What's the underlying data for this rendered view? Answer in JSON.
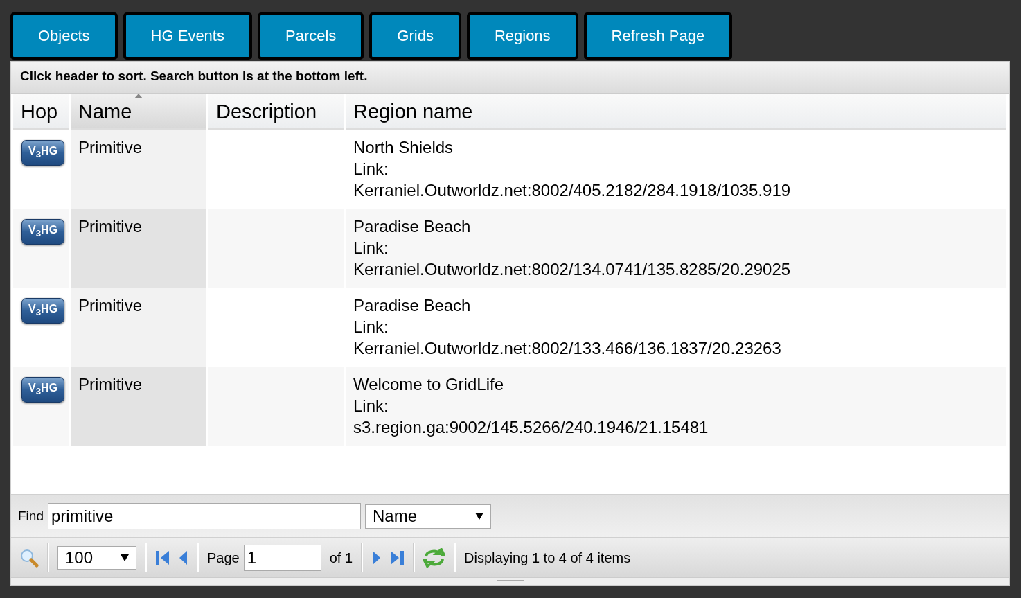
{
  "tabs": [
    {
      "label": "Objects"
    },
    {
      "label": "HG Events"
    },
    {
      "label": "Parcels"
    },
    {
      "label": "Grids"
    },
    {
      "label": "Regions"
    },
    {
      "label": "Refresh Page"
    }
  ],
  "hint": "Click header to sort. Search button is at the bottom left.",
  "columns": [
    {
      "label": "Hop",
      "sorted": false
    },
    {
      "label": "Name",
      "sorted": true
    },
    {
      "label": "Description",
      "sorted": false
    },
    {
      "label": "Region name",
      "sorted": false
    }
  ],
  "rows": [
    {
      "hop": "V$_{3}$HG",
      "name": "Primitive",
      "region": "North Shields",
      "link_label": "Link:",
      "link": "Kerraniel.Outworldz.net:8002/405.2182/284.1918/1035.919"
    },
    {
      "hop": "V$_{3}$HG",
      "name": "Primitive",
      "region": "Paradise Beach",
      "link_label": "Link:",
      "link": "Kerraniel.Outworldz.net:8002/134.0741/135.8285/20.29025"
    },
    {
      "hop": "V$_{3}$HG",
      "name": "Primitive",
      "region": "Paradise Beach",
      "link_label": "Link:",
      "link": "Kerraniel.Outworldz.net:8002/133.466/136.1837/20.23263"
    },
    {
      "hop": "V$_{3}$HG",
      "name": "Primitive",
      "region": "Welcome to GridLife",
      "link_label": "Link:",
      "link": "s3.region.ga:9002/145.5266/240.1946/21.15481"
    }
  ],
  "find": {
    "label": "Find",
    "value": "primitive",
    "field": "Name"
  },
  "pager": {
    "page_size": "100",
    "page_label": "Page",
    "page": "1",
    "of": "of 1",
    "status": "Displaying 1 to 4 of 4 items"
  }
}
